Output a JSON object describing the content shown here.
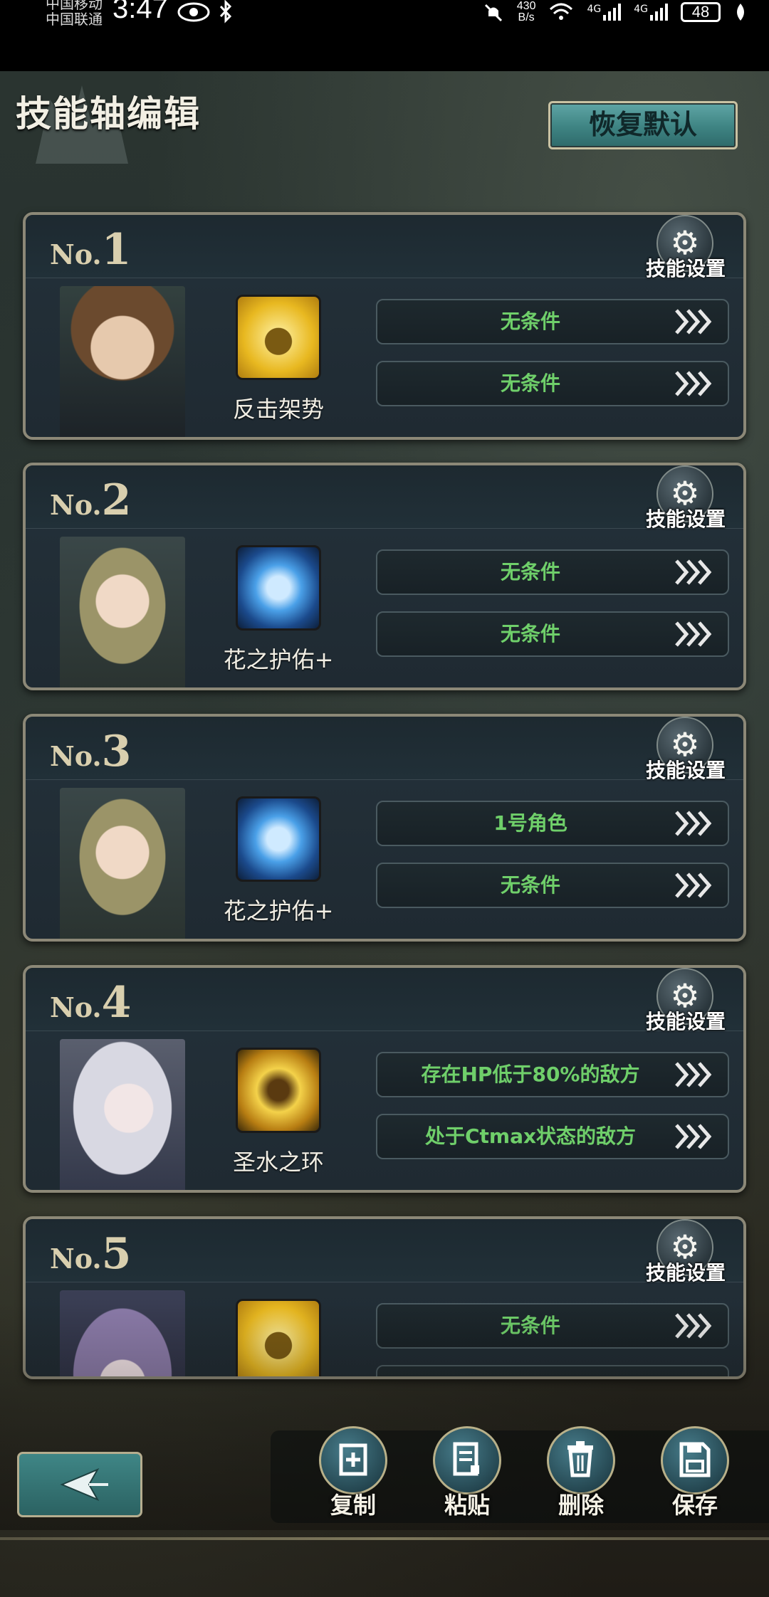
{
  "status_bar": {
    "carrier_1": "中国移动",
    "carrier_2": "中国联通",
    "time": "3:47",
    "net_speed_value": "430",
    "net_speed_unit": "B/s",
    "signal_1": "4G",
    "signal_2": "4G",
    "battery": "48"
  },
  "header": {
    "title": "技能轴编辑",
    "restore_button": "恢复默认"
  },
  "cards": [
    {
      "no_prefix": "No.",
      "number": "1",
      "settings_label": "技能设置",
      "character": "brown-haired-boy",
      "skill_name": "反击架势",
      "skill_icon": "gold-armor-skill-icon",
      "conditions": [
        "无条件",
        "无条件"
      ]
    },
    {
      "no_prefix": "No.",
      "number": "2",
      "settings_label": "技能设置",
      "character": "elf-girl",
      "skill_name": "花之护佑+",
      "skill_icon": "blue-shield-skill-icon",
      "conditions": [
        "无条件",
        "无条件"
      ]
    },
    {
      "no_prefix": "No.",
      "number": "3",
      "settings_label": "技能设置",
      "character": "elf-girl",
      "skill_name": "花之护佑+",
      "skill_icon": "blue-shield-skill-icon",
      "conditions": [
        "1号角色",
        "无条件"
      ]
    },
    {
      "no_prefix": "No.",
      "number": "4",
      "settings_label": "技能设置",
      "character": "white-haired-girl",
      "skill_name": "圣水之环",
      "skill_icon": "gold-holy-skill-icon",
      "conditions": [
        "存在HP低于80%的敌方",
        "处于Ctmax状态的敌方"
      ]
    },
    {
      "no_prefix": "No.",
      "number": "5",
      "settings_label": "技能设置",
      "character": "purple-haired-girl",
      "skill_name": "",
      "skill_icon": "gold-armor-skill-icon",
      "conditions": [
        "无条件"
      ]
    }
  ],
  "toolbar": {
    "copy": "复制",
    "paste": "粘贴",
    "delete": "删除",
    "save": "保存"
  },
  "colors": {
    "condition_text": "#6fcf6a",
    "accent_teal": "#3e8382",
    "frame_gold": "#8c8877"
  }
}
